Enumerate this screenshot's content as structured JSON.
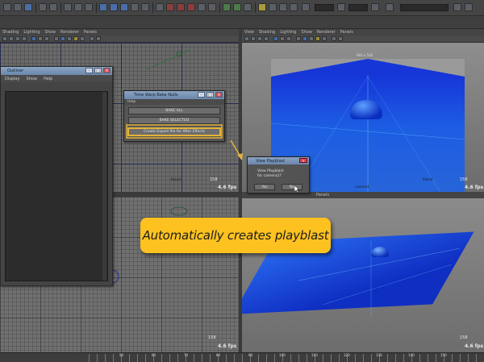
{
  "panel_menu": [
    "View",
    "Shading",
    "Lighting",
    "Show",
    "Renderer",
    "Panels"
  ],
  "panel_menu_topleft": [
    "Shading",
    "Lighting",
    "Show",
    "Renderer",
    "Panels"
  ],
  "panel_menu_botright": [
    "Panels"
  ],
  "viewports": {
    "top_left": {
      "fps": "4.6 fps",
      "frame": "158",
      "camera": "Baked"
    },
    "top_right": {
      "fps": "4.6 fps",
      "frame": "158",
      "camera": "Baked",
      "gate_label": "960 x 540",
      "camera_name": "camera1"
    },
    "bottom_left": {
      "fps": "4.6 fps",
      "frame": "158"
    },
    "bottom_right": {
      "fps": "4.6 fps",
      "frame": "158"
    }
  },
  "outliner": {
    "title": "Outliner",
    "menu": [
      "Display",
      "Show",
      "Help"
    ]
  },
  "bake_dialog": {
    "title": "Time Warp Bake Nulls",
    "menu": "Help",
    "buttons": [
      "BAKE ALL",
      "BAKE SELECTED",
      "Create Export file for After Effects"
    ]
  },
  "playblast_dialog": {
    "title": "View Playblast",
    "message": "View Playblast for camera1?",
    "yes": "Yes",
    "no": "No"
  },
  "annotation": "Automatically creates playblast",
  "timeline": {
    "labels": [
      "50",
      "60",
      "70",
      "80",
      "90",
      "100",
      "110",
      "120",
      "130",
      "140",
      "150"
    ]
  },
  "colors": {
    "accent": "#fdc21f",
    "plane": "#1d5de3"
  },
  "icons": {
    "topbar": [
      "file-icon",
      "save-icon",
      "select-icon",
      "move-icon",
      "rotate-icon",
      "scale-icon",
      "snap-icon",
      "render-icon"
    ]
  }
}
